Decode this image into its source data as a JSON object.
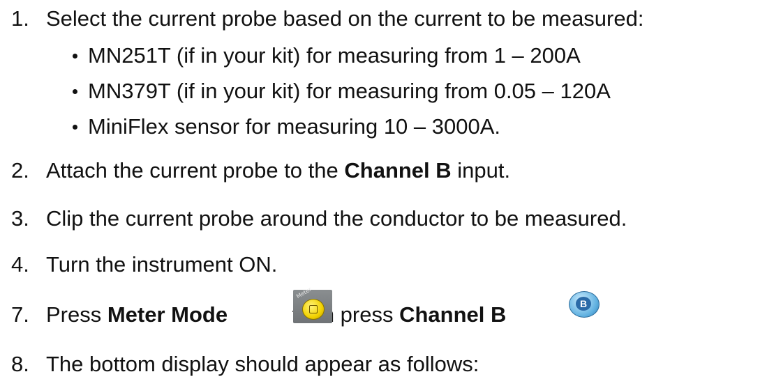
{
  "steps": [
    {
      "num": "1.",
      "text": "Select the current probe based on the current to be measured:"
    },
    {
      "num": "2.",
      "pre": "Attach the current probe to the ",
      "bold": "Channel B",
      "post": " input."
    },
    {
      "num": "3.",
      "text": "Clip the current probe around the conductor to be measured."
    },
    {
      "num": "4.",
      "text": "Turn the instrument ON."
    },
    {
      "num": "7.",
      "pre": "Press ",
      "bold": "Meter Mode",
      "mid": " then press ",
      "bold2": "Channel B"
    },
    {
      "num": "8.",
      "text": "The bottom display should appear as follows:"
    }
  ],
  "bullets": [
    "MN251T (if in your kit) for measuring from 1 – 200A",
    "MN379T (if in your kit) for measuring from 0.05 – 120A",
    "MiniFlex sensor for measuring 10 – 3000A."
  ],
  "icons": {
    "meter_button_label": "Meter",
    "channel_b_button_label": "B",
    "meter_button_color": "#f2d200",
    "channel_b_button_color": "#5fb0e0"
  }
}
